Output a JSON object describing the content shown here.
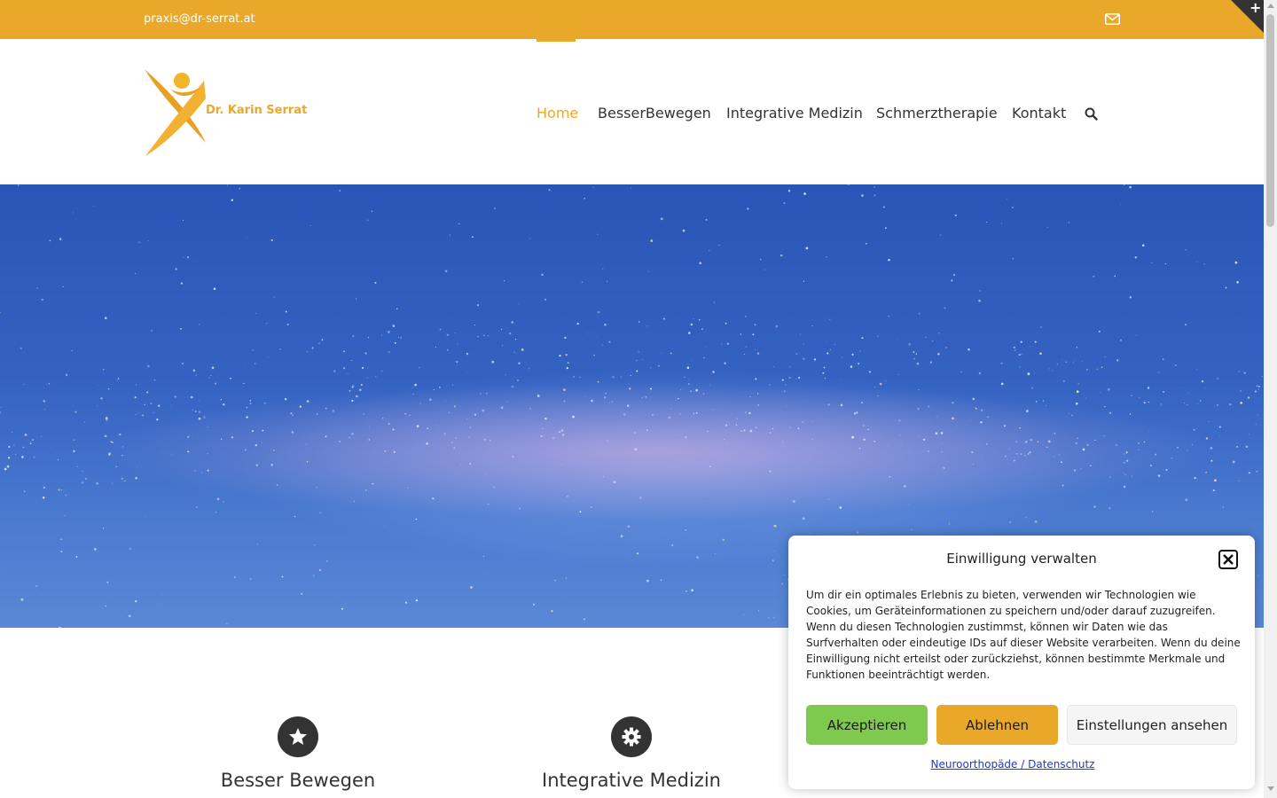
{
  "topbar": {
    "email": "praxis@dr-serrat.at",
    "mail_icon": "envelope-icon",
    "corner_icon": "plus-icon"
  },
  "header": {
    "logo_text": "Dr. Karin Serrat",
    "nav": [
      {
        "label": "Home",
        "active": true
      },
      {
        "label": "BesserBewegen",
        "active": false
      },
      {
        "label": "Integrative Medizin",
        "active": false
      },
      {
        "label": "Schmerztherapie",
        "active": false
      },
      {
        "label": "Kontakt",
        "active": false
      }
    ],
    "search_icon": "search-icon"
  },
  "features": [
    {
      "title": "Besser Bewegen",
      "icon": "star-badge-icon"
    },
    {
      "title": "Integrative Medizin",
      "icon": "gear-icon"
    }
  ],
  "consent": {
    "title": "Einwilligung verwalten",
    "text": "Um dir ein optimales Erlebnis zu bieten, verwenden wir Technologien wie Cookies, um Geräteinformationen zu speichern und/oder darauf zuzugreifen. Wenn du diesen Technologien zustimmst, können wir Daten wie das Surfverhalten oder eindeutige IDs auf dieser Website verarbeiten. Wenn du deine Einwilligung nicht erteilst oder zurückziehst, können bestimmte Merkmale und Funktionen beeinträchtigt werden.",
    "accept_label": "Akzeptieren",
    "deny_label": "Ablehnen",
    "settings_label": "Einstellungen ansehen",
    "link_label": "Neuroorthopäde / Datenschutz"
  },
  "colors": {
    "accent": "#e9a82a",
    "accept": "#7fc94f",
    "dark": "#333333",
    "link": "#1a3bd1"
  }
}
